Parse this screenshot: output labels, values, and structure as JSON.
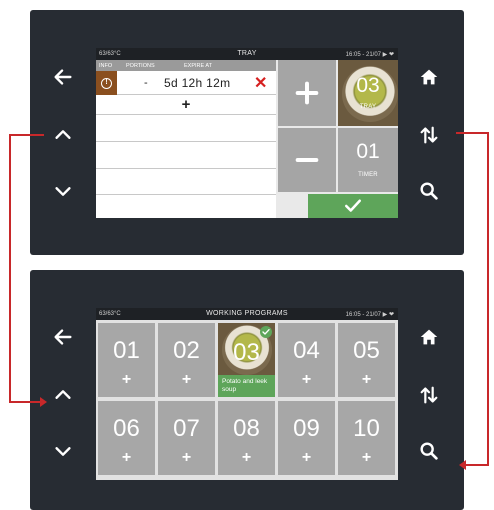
{
  "colors": {
    "bezel": "#272c33",
    "accent_red": "#d62020",
    "confirm_green": "#5ea55a",
    "tile_gray": "#a7a7a7",
    "info_brown": "#8a4f1f"
  },
  "tray_screen": {
    "status": {
      "left": "63/63°C",
      "title": "TRAY",
      "right": "16:05 - 21/07 ▶ ❤"
    },
    "table_headers": {
      "info": "INFO",
      "portions": "PORTIONS",
      "expire": "EXPIRE AT"
    },
    "row": {
      "portions": "-",
      "expire": "5d 12h 12m",
      "delete_icon": "close-icon"
    },
    "add_row_label": "+",
    "buttons": {
      "plus": "plus-icon",
      "minus": "minus-icon",
      "tray_number": "03",
      "tray_label": "TRAY",
      "timer_number": "01",
      "timer_label": "TIMER",
      "confirm": "check-icon"
    }
  },
  "programs_screen": {
    "status": {
      "left": "63/63°C",
      "title": "WORKING PROGRAMS",
      "right": "16:05 - 21/07 ▶ ❤"
    },
    "programs": [
      {
        "number": "01",
        "add": "+"
      },
      {
        "number": "02",
        "add": "+"
      },
      {
        "number": "03",
        "caption": "Potato and leek soup"
      },
      {
        "number": "04",
        "add": "+"
      },
      {
        "number": "05",
        "add": "+"
      },
      {
        "number": "06",
        "add": "+"
      },
      {
        "number": "07",
        "add": "+"
      },
      {
        "number": "08",
        "add": "+"
      },
      {
        "number": "09",
        "add": "+"
      },
      {
        "number": "10",
        "add": "+"
      }
    ]
  },
  "side_nav": {
    "left": [
      "back-arrow-icon",
      "chevron-up-icon",
      "chevron-down-icon"
    ],
    "right": [
      "home-icon",
      "sort-arrows-icon",
      "search-icon"
    ]
  }
}
